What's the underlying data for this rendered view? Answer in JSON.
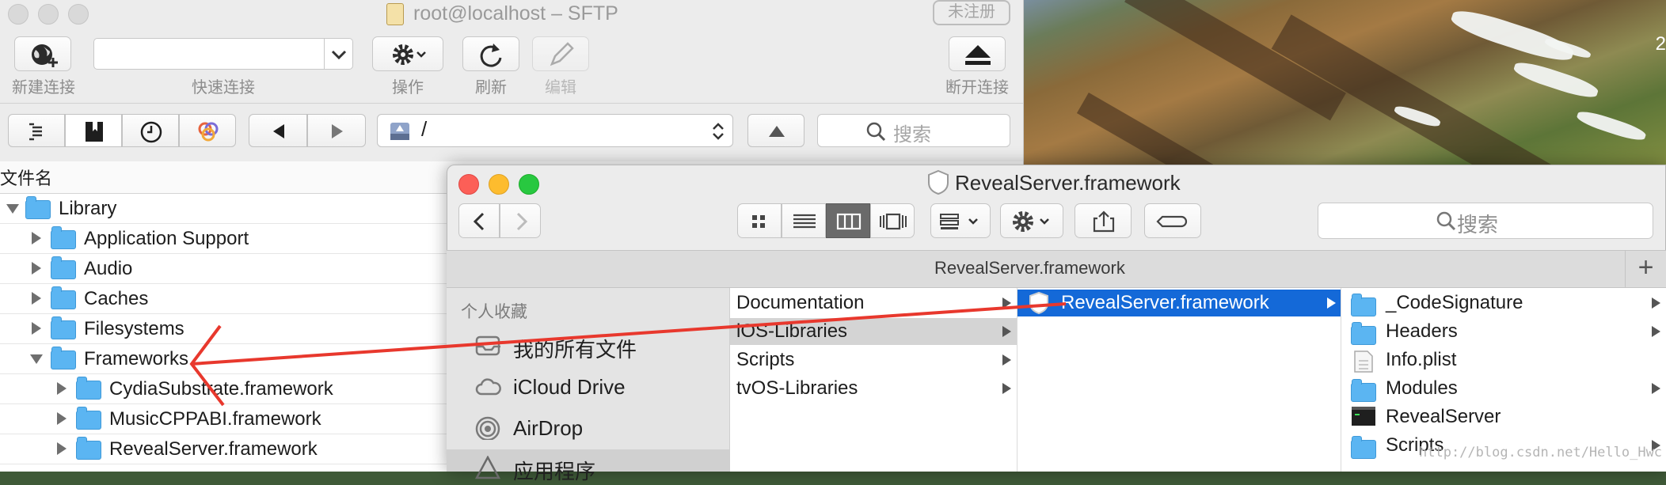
{
  "sftp": {
    "title": "root@localhost – SFTP",
    "unregistered_badge": "未注册",
    "toolbar": {
      "new_connection": "新建连接",
      "quick_connect": "快速连接",
      "quick_connect_value": "",
      "action": "操作",
      "refresh": "刷新",
      "edit": "编辑",
      "disconnect": "断开连接"
    },
    "path": "/",
    "search_placeholder": "搜索",
    "column_header": "文件名",
    "files": [
      {
        "name": "Library",
        "expanded": true
      },
      {
        "name": "Application Support",
        "expanded": false
      },
      {
        "name": "Audio",
        "expanded": false
      },
      {
        "name": "Caches",
        "expanded": false
      },
      {
        "name": "Filesystems",
        "expanded": false
      },
      {
        "name": "Frameworks",
        "expanded": true
      },
      {
        "name": "CydiaSubstrate.framework",
        "expanded": false
      },
      {
        "name": "MusicCPPABI.framework",
        "expanded": false
      },
      {
        "name": "RevealServer.framework",
        "expanded": false
      }
    ]
  },
  "finder": {
    "title": "RevealServer.framework",
    "search_placeholder": "搜索",
    "path_bar": "RevealServer.framework",
    "plus": "+",
    "sidebar": {
      "section": "个人收藏",
      "items": [
        "我的所有文件",
        "iCloud Drive",
        "AirDrop",
        "应用程序"
      ]
    },
    "column1": [
      "Documentation",
      "iOS-Libraries",
      "Scripts",
      "tvOS-Libraries"
    ],
    "column2": [
      "RevealServer.framework"
    ],
    "column3": [
      "_CodeSignature",
      "Headers",
      "Info.plist",
      "Modules",
      "RevealServer",
      "Scripts"
    ]
  },
  "desktop": {
    "partial_text": "2"
  },
  "watermark": "http://blog.csdn.net/Hello_Hwc",
  "colors": {
    "selection": "#1469d8",
    "folder": "#5bb5f2",
    "arrow": "#e8382d"
  }
}
